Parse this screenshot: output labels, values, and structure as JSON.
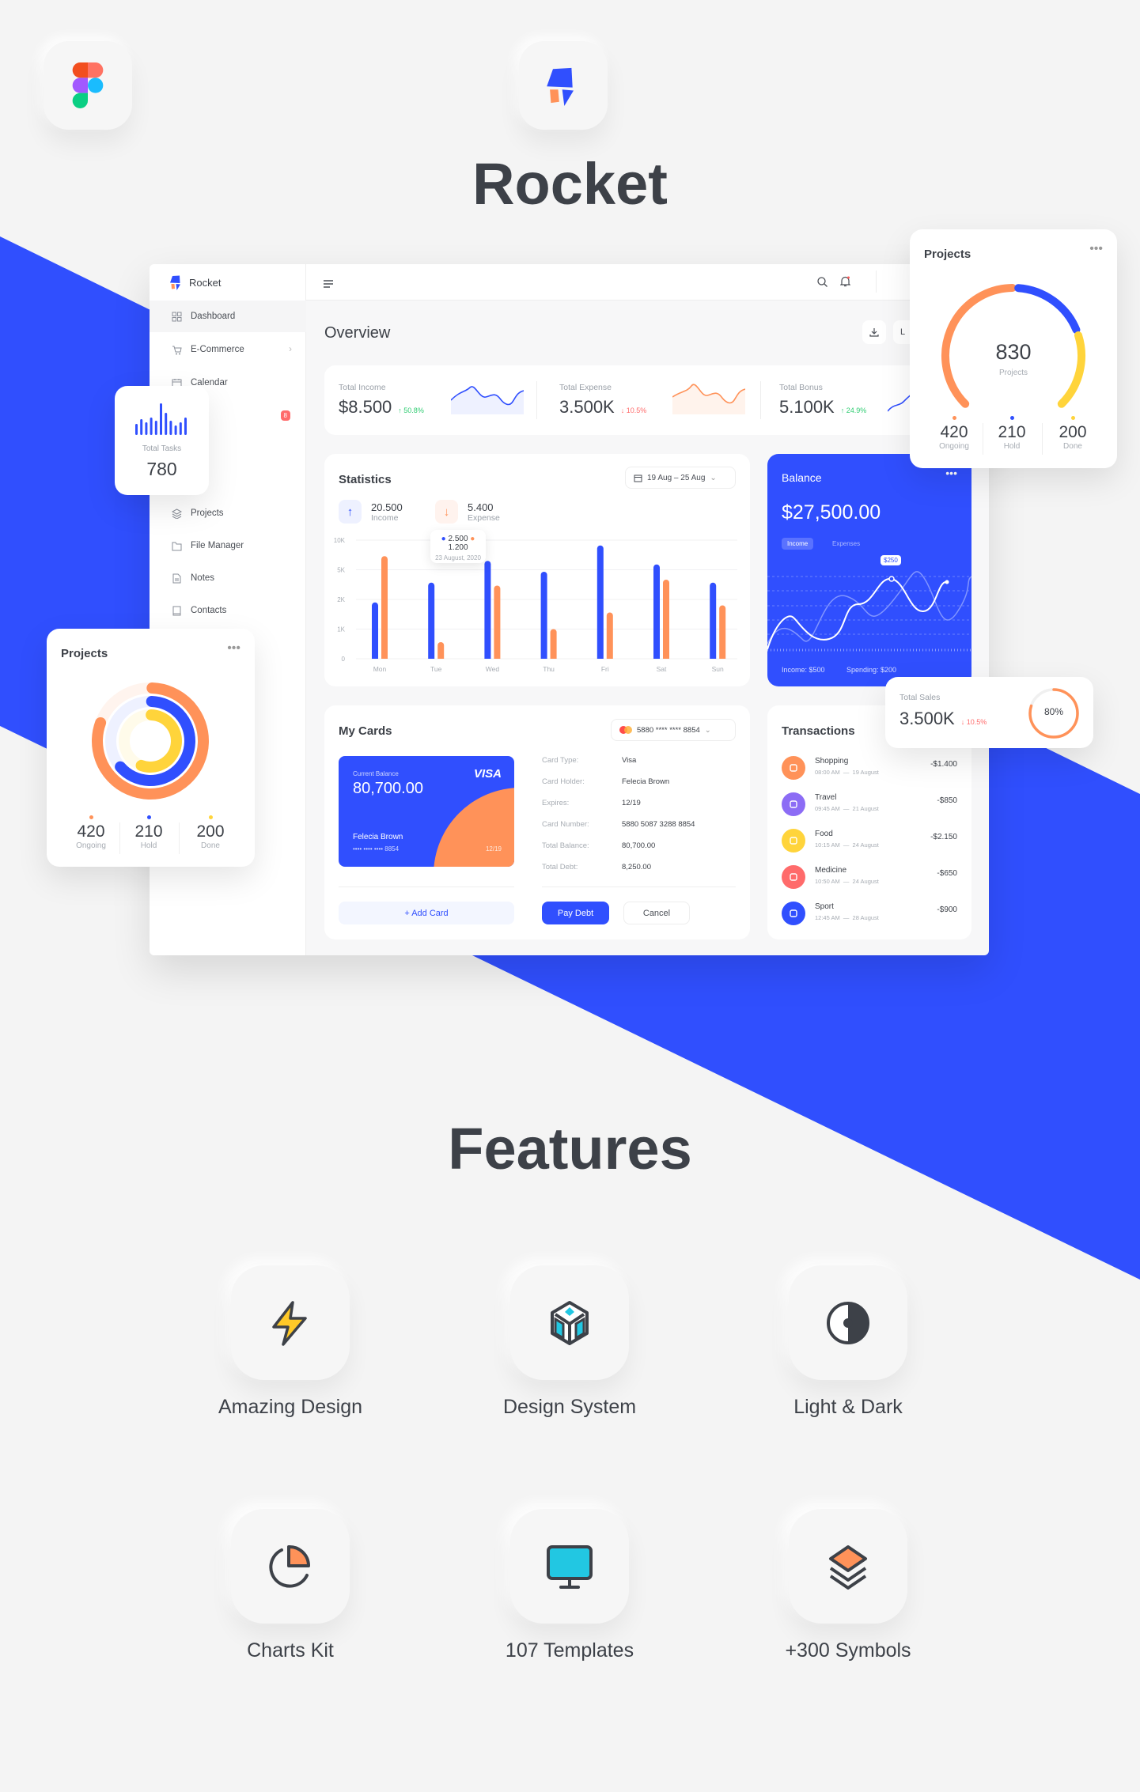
{
  "hero": {
    "title": "Rocket",
    "features_title": "Features"
  },
  "app_icons": [
    "figma-logo",
    "rocket-logo"
  ],
  "colors": {
    "blue": "#304ffe",
    "orange": "#ff9259",
    "yellow": "#ffd43b",
    "green": "#2ecc71",
    "red": "#ff6b6b",
    "purple": "#8c6cf5",
    "dark": "#3d4148"
  },
  "sidebar": {
    "brand": "Rocket",
    "items": [
      {
        "label": "Dashboard",
        "icon": "grid-icon"
      },
      {
        "label": "E-Commerce",
        "icon": "cart-icon"
      },
      {
        "label": "Calendar",
        "icon": "calendar-icon"
      },
      {
        "label": "",
        "badge": "8"
      },
      {
        "label": "Projects",
        "icon": "layers-icon"
      },
      {
        "label": "File Manager",
        "icon": "folder-icon"
      },
      {
        "label": "Notes",
        "icon": "note-icon"
      },
      {
        "label": "Contacts",
        "icon": "book-icon"
      }
    ]
  },
  "header": {
    "page_title": "Overview",
    "range_button": "L"
  },
  "summary": [
    {
      "label": "Total Income",
      "value": "$8.500",
      "change": "↑ 50.8%",
      "trend": "up"
    },
    {
      "label": "Total Expense",
      "value": "3.500K",
      "change": "↓ 10.5%",
      "trend": "down"
    },
    {
      "label": "Total Bonus",
      "value": "5.100K",
      "change": "↑ 24.9%",
      "trend": "up"
    }
  ],
  "statistics": {
    "title": "Statistics",
    "date_range": "19 Aug – 25 Aug",
    "income": {
      "value": "20.500",
      "label": "Income"
    },
    "expense": {
      "value": "5.400",
      "label": "Expense"
    },
    "tooltip": {
      "income": "2.500",
      "expense": "1.200",
      "date": "23 August, 2020"
    },
    "chart_data": {
      "type": "bar",
      "categories": [
        "Mon",
        "Tue",
        "Wed",
        "Thu",
        "Fri",
        "Sat",
        "Sun"
      ],
      "y_ticks": [
        "10K",
        "5K",
        "2K",
        "1K",
        "0"
      ],
      "y_tick_values": [
        10000,
        5000,
        2000,
        1000,
        0
      ],
      "series": [
        {
          "color": "#304ffe",
          "values": [
            1900,
            3700,
            6500,
            4800,
            9100,
            5900,
            3700
          ]
        },
        {
          "color": "#ff9259",
          "values": [
            7300,
            560,
            3400,
            1000,
            1560,
            4000,
            1800
          ]
        }
      ]
    }
  },
  "balance": {
    "title": "Balance",
    "amount": "$27,500.00",
    "tabs": [
      "Income",
      "Expenses"
    ],
    "marker": "$250",
    "income": "Income: $500",
    "spending": "Spending: $200"
  },
  "cards": {
    "title": "My Cards",
    "selected": "5880 **** **** 8854",
    "card": {
      "balance_label": "Current Balance",
      "balance": "80,700.00",
      "brand": "VISA",
      "holder": "Felecia Brown",
      "number": "•••• •••• •••• 8854",
      "expires": "12/19"
    },
    "details": [
      {
        "label": "Card Type:",
        "value": "Visa"
      },
      {
        "label": "Card Holder:",
        "value": "Felecia Brown"
      },
      {
        "label": "Expires:",
        "value": "12/19"
      },
      {
        "label": "Card Number:",
        "value": "5880 5087 3288 8854"
      },
      {
        "label": "Total Balance:",
        "value": "80,700.00"
      },
      {
        "label": "Total Debt:",
        "value": "8,250.00"
      }
    ],
    "add_card": "+ Add Card",
    "pay_debt": "Pay Debt",
    "cancel": "Cancel"
  },
  "transactions": {
    "title": "Transactions",
    "items": [
      {
        "name": "Shopping",
        "time": "08:00 AM  —  19 August",
        "amount": "-$1.400",
        "color": "#ff9259",
        "icon": "bag-icon"
      },
      {
        "name": "Travel",
        "time": "09:45 AM  —  21 August",
        "amount": "-$850",
        "color": "#8c6cf5",
        "icon": "luggage-icon"
      },
      {
        "name": "Food",
        "time": "10:15 AM  —  24 August",
        "amount": "-$2.150",
        "color": "#ffd43b",
        "icon": "cart-icon"
      },
      {
        "name": "Medicine",
        "time": "10:50 AM  —  24 August",
        "amount": "-$650",
        "color": "#ff6b6b",
        "icon": "heart-icon"
      },
      {
        "name": "Sport",
        "time": "12:45 AM  —  28 August",
        "amount": "-$900",
        "color": "#304ffe",
        "icon": "dumbbell-icon"
      }
    ]
  },
  "projects_gauge": {
    "title": "Projects",
    "total": "830",
    "total_label": "Projects",
    "stats": [
      {
        "value": "420",
        "label": "Ongoing",
        "color": "#ff9259"
      },
      {
        "value": "210",
        "label": "Hold",
        "color": "#304ffe"
      },
      {
        "value": "200",
        "label": "Done",
        "color": "#ffd43b"
      }
    ]
  },
  "projects_donut": {
    "title": "Projects",
    "fractions": [
      0.8,
      0.63,
      0.55
    ],
    "stats": [
      {
        "value": "420",
        "label": "Ongoing",
        "color": "#ff9259"
      },
      {
        "value": "210",
        "label": "Hold",
        "color": "#304ffe"
      },
      {
        "value": "200",
        "label": "Done",
        "color": "#ffd43b"
      }
    ]
  },
  "total_tasks": {
    "label": "Total Tasks",
    "value": "780",
    "bars": [
      0.35,
      0.5,
      0.4,
      0.55,
      0.45,
      1,
      0.7,
      0.45,
      0.3,
      0.4,
      0.55
    ]
  },
  "total_sales": {
    "label": "Total Sales",
    "value": "3.500K",
    "change": "↓ 10.5%",
    "progress": 0.8,
    "progress_label": "80%"
  },
  "features": [
    {
      "label": "Amazing Design",
      "icon": "lightning-icon"
    },
    {
      "label": "Design System",
      "icon": "cube-icon"
    },
    {
      "label": "Light & Dark",
      "icon": "contrast-icon"
    },
    {
      "label": "Charts Kit",
      "icon": "pie-chart-icon"
    },
    {
      "label": "107 Templates",
      "icon": "monitor-icon"
    },
    {
      "label": "+300 Symbols",
      "icon": "layers-icon"
    }
  ]
}
